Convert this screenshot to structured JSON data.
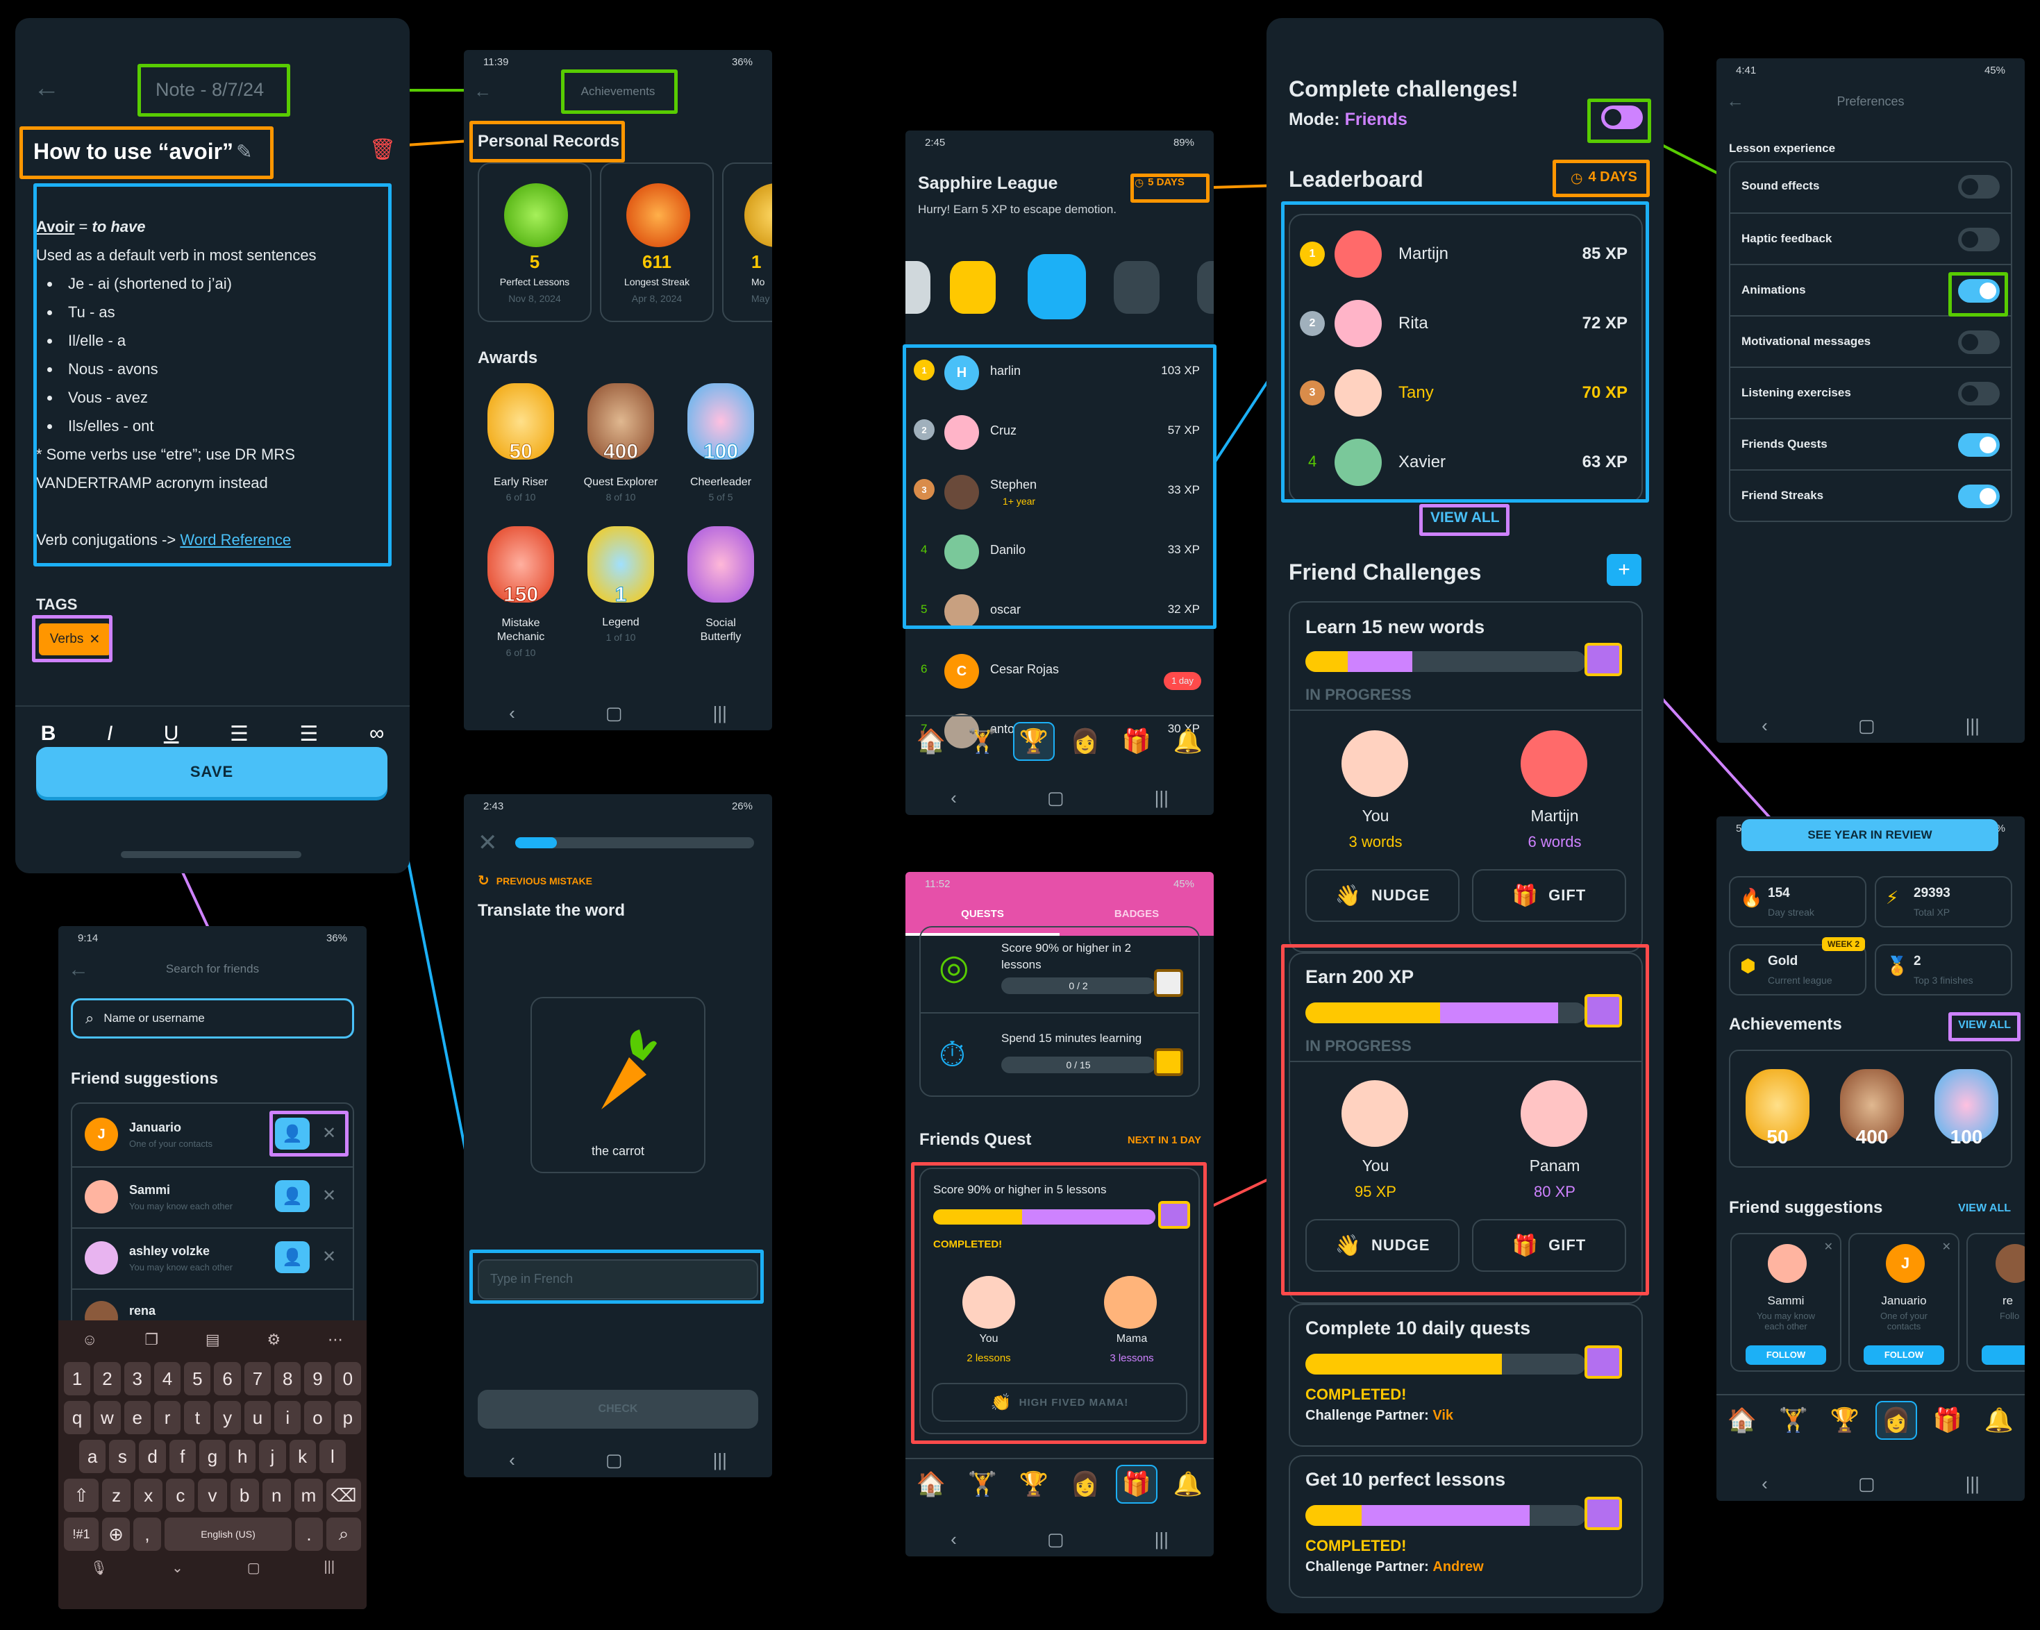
{
  "colors": {
    "bg": "#000000",
    "screen": "#15212a",
    "green": "#58cc02",
    "orange": "#ff9600",
    "blue": "#1cb0f6",
    "purple": "#ce82ff",
    "red": "#ff4b4b",
    "gold": "#ffc800",
    "pink": "#e650a9"
  },
  "note": {
    "title": "Note - 8/7/24",
    "heading": "How to use “avoir”",
    "word": "Avoir",
    "meaning": "to have",
    "line1": "Used as a default verb in most sentences",
    "conj": [
      "Je - ai (shortened to j’ai)",
      "Tu - as",
      "Il/elle - a",
      "Nous - avons",
      "Vous - avez",
      "Ils/elles - ont"
    ],
    "note1": "* Some verbs use “etre”; use DR MRS",
    "note2": "VANDERTRAMP acronym instead",
    "verb_prefix": "Verb conjugations ->",
    "link": "Word Reference",
    "tags_label": "TAGS",
    "tag": "Verbs",
    "save": "SAVE",
    "toolbar": [
      "B",
      "I",
      "U",
      "☰",
      "☰",
      "∞"
    ]
  },
  "search": {
    "time": "9:14",
    "battery": "36%",
    "title": "Search for friends",
    "placeholder": "Name or username",
    "section": "Friend suggestions",
    "people": [
      {
        "name": "Januario",
        "sub": "One of your contacts",
        "initial": "J"
      },
      {
        "name": "Sammi",
        "sub": "You may know each other"
      },
      {
        "name": "ashley volzke",
        "sub": "You may know each other"
      },
      {
        "name": "rena",
        "sub": ""
      }
    ],
    "kb_row1": [
      "1",
      "2",
      "3",
      "4",
      "5",
      "6",
      "7",
      "8",
      "9",
      "0"
    ],
    "kb_row2": [
      "q",
      "w",
      "e",
      "r",
      "t",
      "y",
      "u",
      "i",
      "o",
      "p"
    ],
    "kb_row3": [
      "a",
      "s",
      "d",
      "f",
      "g",
      "h",
      "j",
      "k",
      "l"
    ],
    "kb_row4": [
      "z",
      "x",
      "c",
      "v",
      "b",
      "n",
      "m"
    ],
    "kb_sym": "!#1",
    "kb_comma": ",",
    "kb_space": "English (US)",
    "kb_dot": "."
  },
  "achievements": {
    "time": "11:39",
    "battery": "36%",
    "title": "Achievements",
    "records_title": "Personal Records",
    "records": [
      {
        "value": "5",
        "label": "Perfect Lessons",
        "date": "Nov 8, 2024"
      },
      {
        "value": "611",
        "label": "Longest Streak",
        "date": "Apr 8, 2024"
      },
      {
        "value": "1",
        "label": "Mo",
        "date": "May"
      }
    ],
    "awards_title": "Awards",
    "awards": [
      {
        "num": "50",
        "name": "Early Riser",
        "prog": "6 of 10"
      },
      {
        "num": "400",
        "name": "Quest Explorer",
        "prog": "8 of 10"
      },
      {
        "num": "100",
        "name": "Cheerleader",
        "prog": "5 of 5"
      },
      {
        "num": "150",
        "name": "Mistake Mechanic",
        "prog": "6 of 10"
      },
      {
        "num": "1",
        "name": "Legend",
        "prog": "1 of 10"
      },
      {
        "num": "",
        "name": "Social Butterfly",
        "prog": ""
      }
    ]
  },
  "translate": {
    "time": "2:43",
    "battery": "26%",
    "badge": "PREVIOUS MISTAKE",
    "prompt": "Translate the word",
    "word": "the carrot",
    "placeholder": "Type in French",
    "check": "CHECK"
  },
  "league": {
    "time": "2:45",
    "battery": "89%",
    "title": "Sapphire League",
    "days": "5 DAYS",
    "subtitle": "Hurry! Earn 5 XP to escape demotion.",
    "rows": [
      {
        "rank": "1",
        "name": "harlin",
        "xp": "103 XP",
        "initial": "H"
      },
      {
        "rank": "2",
        "name": "Cruz",
        "xp": "57 XP"
      },
      {
        "rank": "3",
        "name": "Stephen",
        "xp": "33 XP",
        "extra": "1+ year"
      },
      {
        "rank": "4",
        "name": "Danilo",
        "xp": "33 XP"
      },
      {
        "rank": "5",
        "name": "oscar",
        "xp": "32 XP"
      },
      {
        "rank": "6",
        "name": "Cesar Rojas",
        "xp": "",
        "initial": "C"
      },
      {
        "rank": "7",
        "name": "antonio",
        "xp": "30 XP"
      }
    ],
    "one_day": "1 day"
  },
  "quests": {
    "time": "11:52",
    "battery": "45%",
    "tab1": "QUESTS",
    "tab2": "BADGES",
    "q1": "Score 90% or higher in 2 lessons",
    "q1p": "0 / 2",
    "q2": "Spend 15 minutes learning",
    "q2p": "0 / 15",
    "fq_title": "Friends Quest",
    "fq_next": "NEXT IN 1 DAY",
    "fq_task": "Score 90% or higher in 5 lessons",
    "fq_status": "COMPLETED!",
    "you": "You",
    "you_val": "2 lessons",
    "mama": "Mama",
    "mama_val": "3 lessons",
    "high_five": "HIGH FIVED MAMA!"
  },
  "challenges": {
    "title": "Complete challenges!",
    "mode_label": "Mode:",
    "mode": "Friends",
    "lb_title": "Leaderboard",
    "lb_days": "4 DAYS",
    "lb": [
      {
        "rank": "1",
        "name": "Martijn",
        "xp": "85 XP"
      },
      {
        "rank": "2",
        "name": "Rita",
        "xp": "72 XP"
      },
      {
        "rank": "3",
        "name": "Tany",
        "xp": "70 XP"
      },
      {
        "rank": "4",
        "name": "Xavier",
        "xp": "63 XP"
      }
    ],
    "view_all": "VIEW ALL",
    "fc_title": "Friend Challenges",
    "plus": "+",
    "c1": {
      "title": "Learn 15 new words",
      "status": "IN PROGRESS",
      "you": "You",
      "you_val": "3 words",
      "other": "Martijn",
      "other_val": "6 words",
      "y": 0.15,
      "p": 0.38
    },
    "c2": {
      "title": "Earn 200 XP",
      "status": "IN PROGRESS",
      "you": "You",
      "you_val": "95 XP",
      "other": "Panam",
      "other_val": "80 XP",
      "y": 0.48,
      "p": 0.9
    },
    "nudge": "NUDGE",
    "gift": "GIFT",
    "c3": {
      "title": "Complete 10 daily quests",
      "status": "COMPLETED!",
      "partner_label": "Challenge Partner:",
      "partner": "Vik",
      "y": 0.7,
      "p": 0.3
    },
    "c4": {
      "title": "Get 10 perfect lessons",
      "status": "COMPLETED!",
      "partner_label": "Challenge Partner:",
      "partner": "Andrew",
      "y": 0.2,
      "p": 0.8
    }
  },
  "prefs": {
    "time": "4:41",
    "battery": "45%",
    "title": "Preferences",
    "section": "Lesson experience",
    "items": [
      {
        "label": "Sound effects",
        "on": false
      },
      {
        "label": "Haptic feedback",
        "on": false
      },
      {
        "label": "Animations",
        "on": true
      },
      {
        "label": "Motivational messages",
        "on": false
      },
      {
        "label": "Listening exercises",
        "on": false
      },
      {
        "label": "Friends Quests",
        "on": true
      },
      {
        "label": "Friend Streaks",
        "on": true
      }
    ]
  },
  "profile": {
    "time": "5:43",
    "battery": "77%",
    "review": "SEE YEAR IN REVIEW",
    "stats": [
      {
        "val": "154",
        "label": "Day streak"
      },
      {
        "val": "29393",
        "label": "Total XP"
      },
      {
        "val": "Gold",
        "label": "Current league",
        "tag": "WEEK 2"
      },
      {
        "val": "2",
        "label": "Top 3 finishes"
      }
    ],
    "ach_title": "Achievements",
    "view_all": "VIEW ALL",
    "ach": [
      "50",
      "400",
      "100"
    ],
    "fs_title": "Friend suggestions",
    "fs_view": "VIEW ALL",
    "fs": [
      {
        "name": "Sammi",
        "sub": "You may know each other"
      },
      {
        "name": "Januario",
        "sub": "One of your contacts",
        "initial": "J"
      },
      {
        "name": "re",
        "sub": "Follo"
      }
    ],
    "follow": "FOLLOW"
  }
}
